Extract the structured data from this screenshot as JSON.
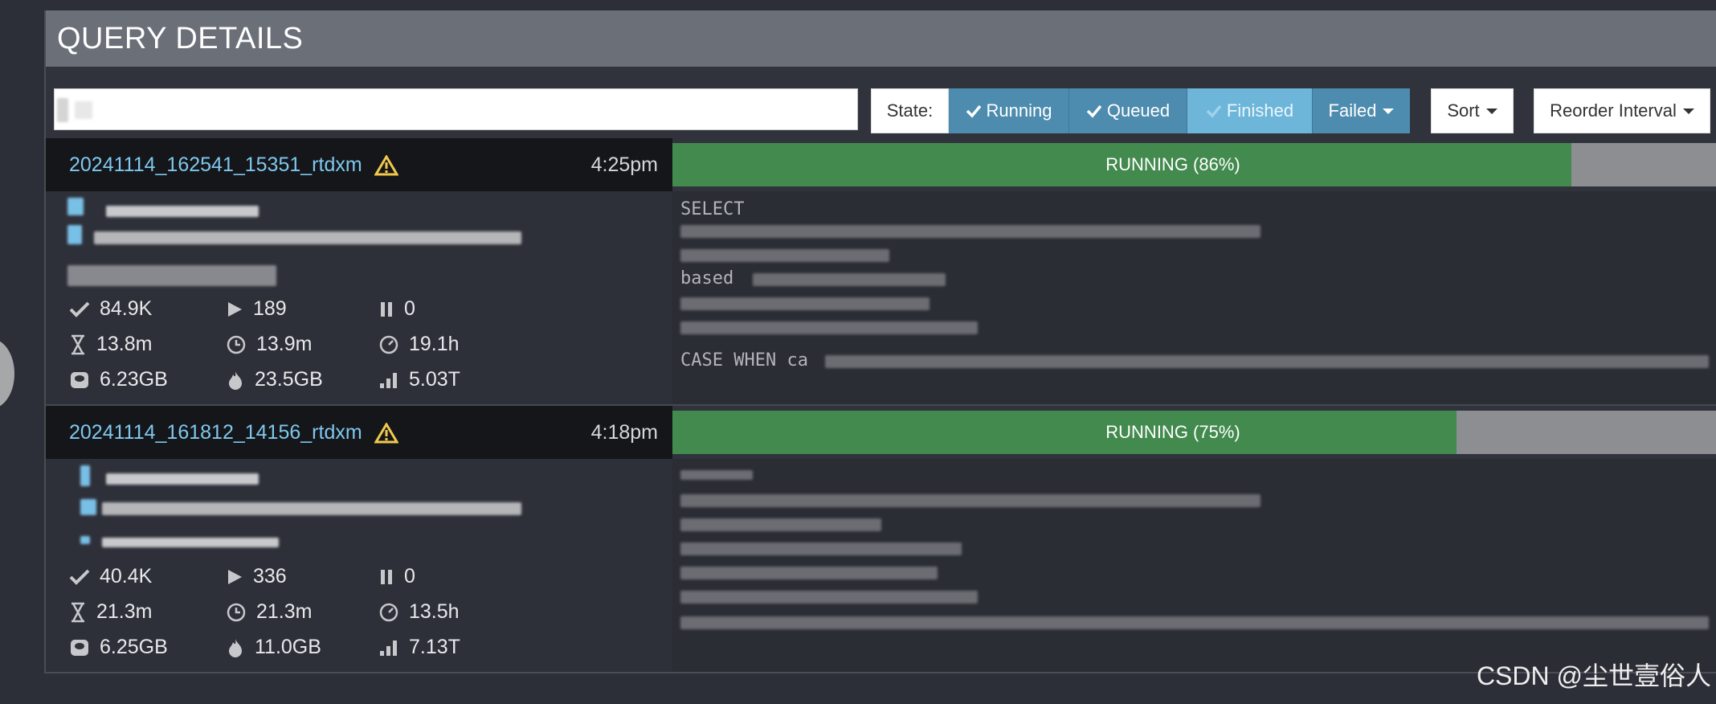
{
  "header": {
    "title": "QUERY DETAILS"
  },
  "toolbar": {
    "search_value": "",
    "state_label": "State:",
    "filters": {
      "running": "Running",
      "queued": "Queued",
      "finished": "Finished",
      "failed": "Failed"
    },
    "sort_label": "Sort",
    "reorder_label": "Reorder Interval"
  },
  "colors": {
    "accent": "#4d8cae",
    "progress": "#438a4e",
    "warning": "#f2c94c",
    "link": "#7fc8ee"
  },
  "queries": [
    {
      "id": "20241114_162541_15351_rtdxm",
      "time": "4:25pm",
      "status": "RUNNING (86%)",
      "progress": 0.86,
      "sql_first": "SELECT",
      "sql_lines": [
        "based",
        "CASE WHEN ca"
      ],
      "stats": {
        "completed": "84.9K",
        "running": "189",
        "blocked": "0",
        "wall": "13.8m",
        "elapsed": "13.9m",
        "cpu": "19.1h",
        "memory": "6.23GB",
        "peak": "23.5GB",
        "input": "5.03T"
      }
    },
    {
      "id": "20241114_161812_14156_rtdxm",
      "time": "4:18pm",
      "status": "RUNNING (75%)",
      "progress": 0.75,
      "sql_first": "",
      "sql_lines": [],
      "stats": {
        "completed": "40.4K",
        "running": "336",
        "blocked": "0",
        "wall": "21.3m",
        "elapsed": "21.3m",
        "cpu": "13.5h",
        "memory": "6.25GB",
        "peak": "11.0GB",
        "input": "7.13T"
      }
    }
  ],
  "watermark": "CSDN @尘世壹俗人"
}
